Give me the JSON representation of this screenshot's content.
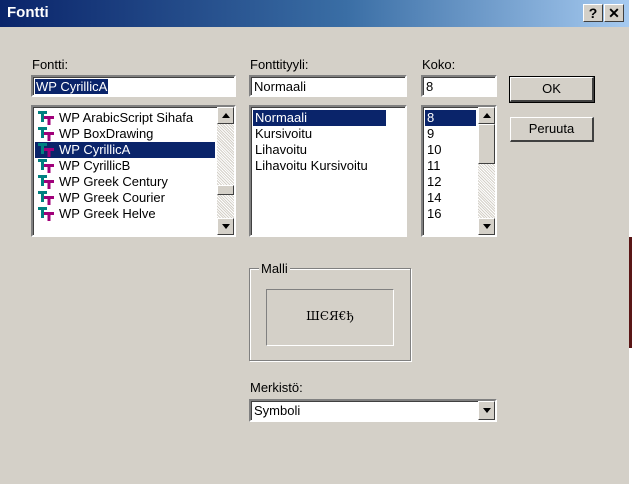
{
  "window": {
    "title": "Fontti"
  },
  "titlebar_buttons": {
    "help": "?",
    "close": "✕"
  },
  "font": {
    "label": "Fontti:",
    "value": "WP CyrillicA",
    "items": [
      {
        "label": "WP ArabicScript Sihafa",
        "icon": "truetype-font-icon",
        "selected": false
      },
      {
        "label": "WP BoxDrawing",
        "icon": "truetype-font-icon",
        "selected": false
      },
      {
        "label": "WP CyrillicA",
        "icon": "truetype-font-icon",
        "selected": true
      },
      {
        "label": "WP CyrillicB",
        "icon": "truetype-font-icon",
        "selected": false
      },
      {
        "label": "WP Greek Century",
        "icon": "truetype-font-icon",
        "selected": false
      },
      {
        "label": "WP Greek Courier",
        "icon": "truetype-font-icon",
        "selected": false
      },
      {
        "label": "WP Greek Helve",
        "icon": "truetype-font-icon",
        "selected": false
      }
    ]
  },
  "style": {
    "label": "Fonttityyli:",
    "value": "Normaali",
    "items": [
      {
        "label": "Normaali",
        "selected": true
      },
      {
        "label": "Kursivoitu",
        "selected": false
      },
      {
        "label": "Lihavoitu",
        "selected": false
      },
      {
        "label": "Lihavoitu Kursivoitu",
        "selected": false
      }
    ]
  },
  "size": {
    "label": "Koko:",
    "value": "8",
    "items": [
      {
        "label": "8",
        "selected": true
      },
      {
        "label": "9",
        "selected": false
      },
      {
        "label": "10",
        "selected": false
      },
      {
        "label": "11",
        "selected": false
      },
      {
        "label": "12",
        "selected": false
      },
      {
        "label": "14",
        "selected": false
      },
      {
        "label": "16",
        "selected": false
      }
    ]
  },
  "buttons": {
    "ok": "OK",
    "cancel": "Peruuta"
  },
  "sample": {
    "label": "Malli",
    "text": "ШЄЯ€ђ"
  },
  "charset": {
    "label": "Merkistö:",
    "value": "Symboli"
  },
  "colors": {
    "selection": "#0a246a",
    "face": "#d4d0c8",
    "icon_teal": "#008080",
    "icon_magenta": "#a0007a"
  }
}
